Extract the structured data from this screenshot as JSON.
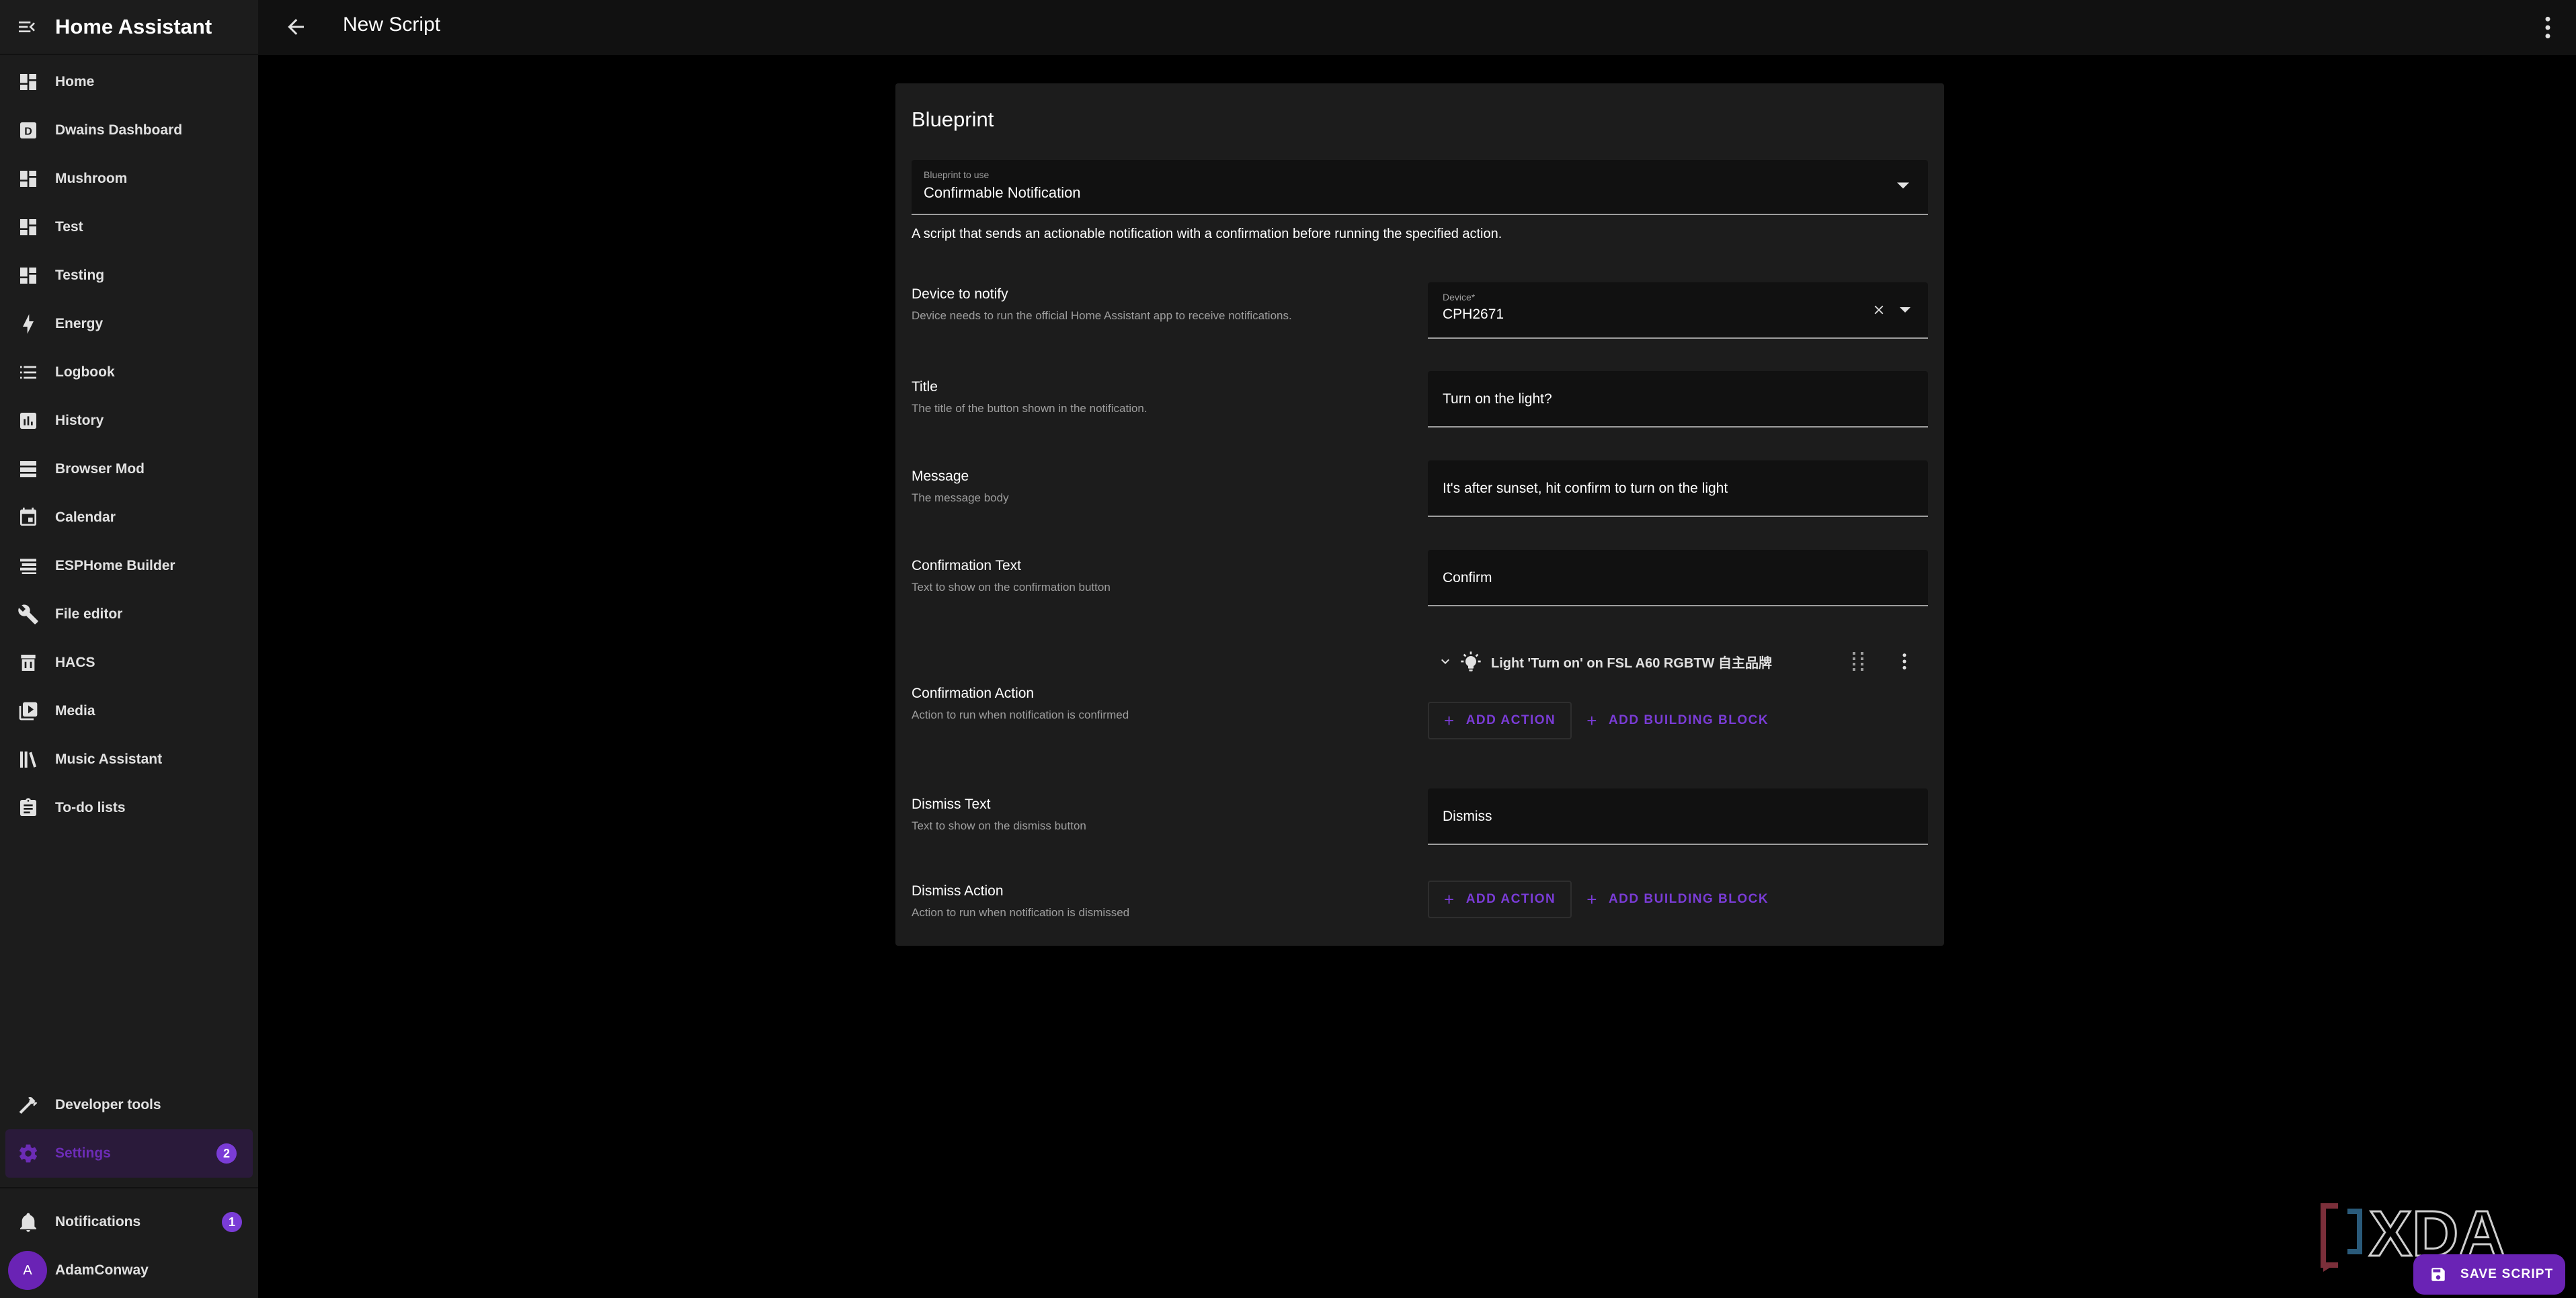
{
  "app": {
    "title": "Home Assistant"
  },
  "sidebar": {
    "items": [
      {
        "label": "Home",
        "icon": "dashboard-icon"
      },
      {
        "label": "Dwains Dashboard",
        "icon": "dwains-icon"
      },
      {
        "label": "Mushroom",
        "icon": "dashboard-icon"
      },
      {
        "label": "Test",
        "icon": "dashboard-icon"
      },
      {
        "label": "Testing",
        "icon": "dashboard-icon"
      },
      {
        "label": "Energy",
        "icon": "lightning-icon"
      },
      {
        "label": "Logbook",
        "icon": "list-icon"
      },
      {
        "label": "History",
        "icon": "chart-box-icon"
      },
      {
        "label": "Browser Mod",
        "icon": "server-icon"
      },
      {
        "label": "Calendar",
        "icon": "calendar-icon"
      },
      {
        "label": "ESPHome Builder",
        "icon": "esphome-icon"
      },
      {
        "label": "File editor",
        "icon": "wrench-icon"
      },
      {
        "label": "HACS",
        "icon": "hacs-icon"
      },
      {
        "label": "Media",
        "icon": "media-icon"
      },
      {
        "label": "Music Assistant",
        "icon": "library-icon"
      },
      {
        "label": "To-do lists",
        "icon": "clipboard-icon"
      }
    ],
    "developer_tools": "Developer tools",
    "settings": "Settings",
    "settings_badge": "2",
    "notifications": "Notifications",
    "notifications_badge": "1",
    "user": "AdamConway",
    "user_initial": "A",
    "accent": "#6c2cb6"
  },
  "topbar": {
    "title": "New Script"
  },
  "blueprint": {
    "heading": "Blueprint",
    "select_label": "Blueprint to use",
    "select_value": "Confirmable Notification",
    "description": "A script that sends an actionable notification with a confirmation before running the specified action."
  },
  "fields": {
    "device": {
      "label": "Device to notify",
      "desc": "Device needs to run the official Home Assistant app to receive notifications.",
      "field_label": "Device*",
      "value": "CPH2671"
    },
    "title": {
      "label": "Title",
      "desc": "The title of the button shown in the notification.",
      "value": "Turn on the light?"
    },
    "message": {
      "label": "Message",
      "desc": "The message body",
      "value": "It's after sunset, hit confirm to turn on the light"
    },
    "confirm_text": {
      "label": "Confirmation Text",
      "desc": "Text to show on the confirmation button",
      "value": "Confirm"
    },
    "confirm_action": {
      "label": "Confirmation Action",
      "desc": "Action to run when notification is confirmed",
      "action_text": "Light 'Turn on' on FSL A60 RGBTW 自主品牌"
    },
    "dismiss_text": {
      "label": "Dismiss Text",
      "desc": "Text to show on the dismiss button",
      "value": "Dismiss"
    },
    "dismiss_action": {
      "label": "Dismiss Action",
      "desc": "Action to run when notification is dismissed"
    }
  },
  "buttons": {
    "add_action": "ADD ACTION",
    "add_building_block": "ADD BUILDING BLOCK",
    "save_script": "SAVE SCRIPT"
  },
  "watermark": "XDA"
}
